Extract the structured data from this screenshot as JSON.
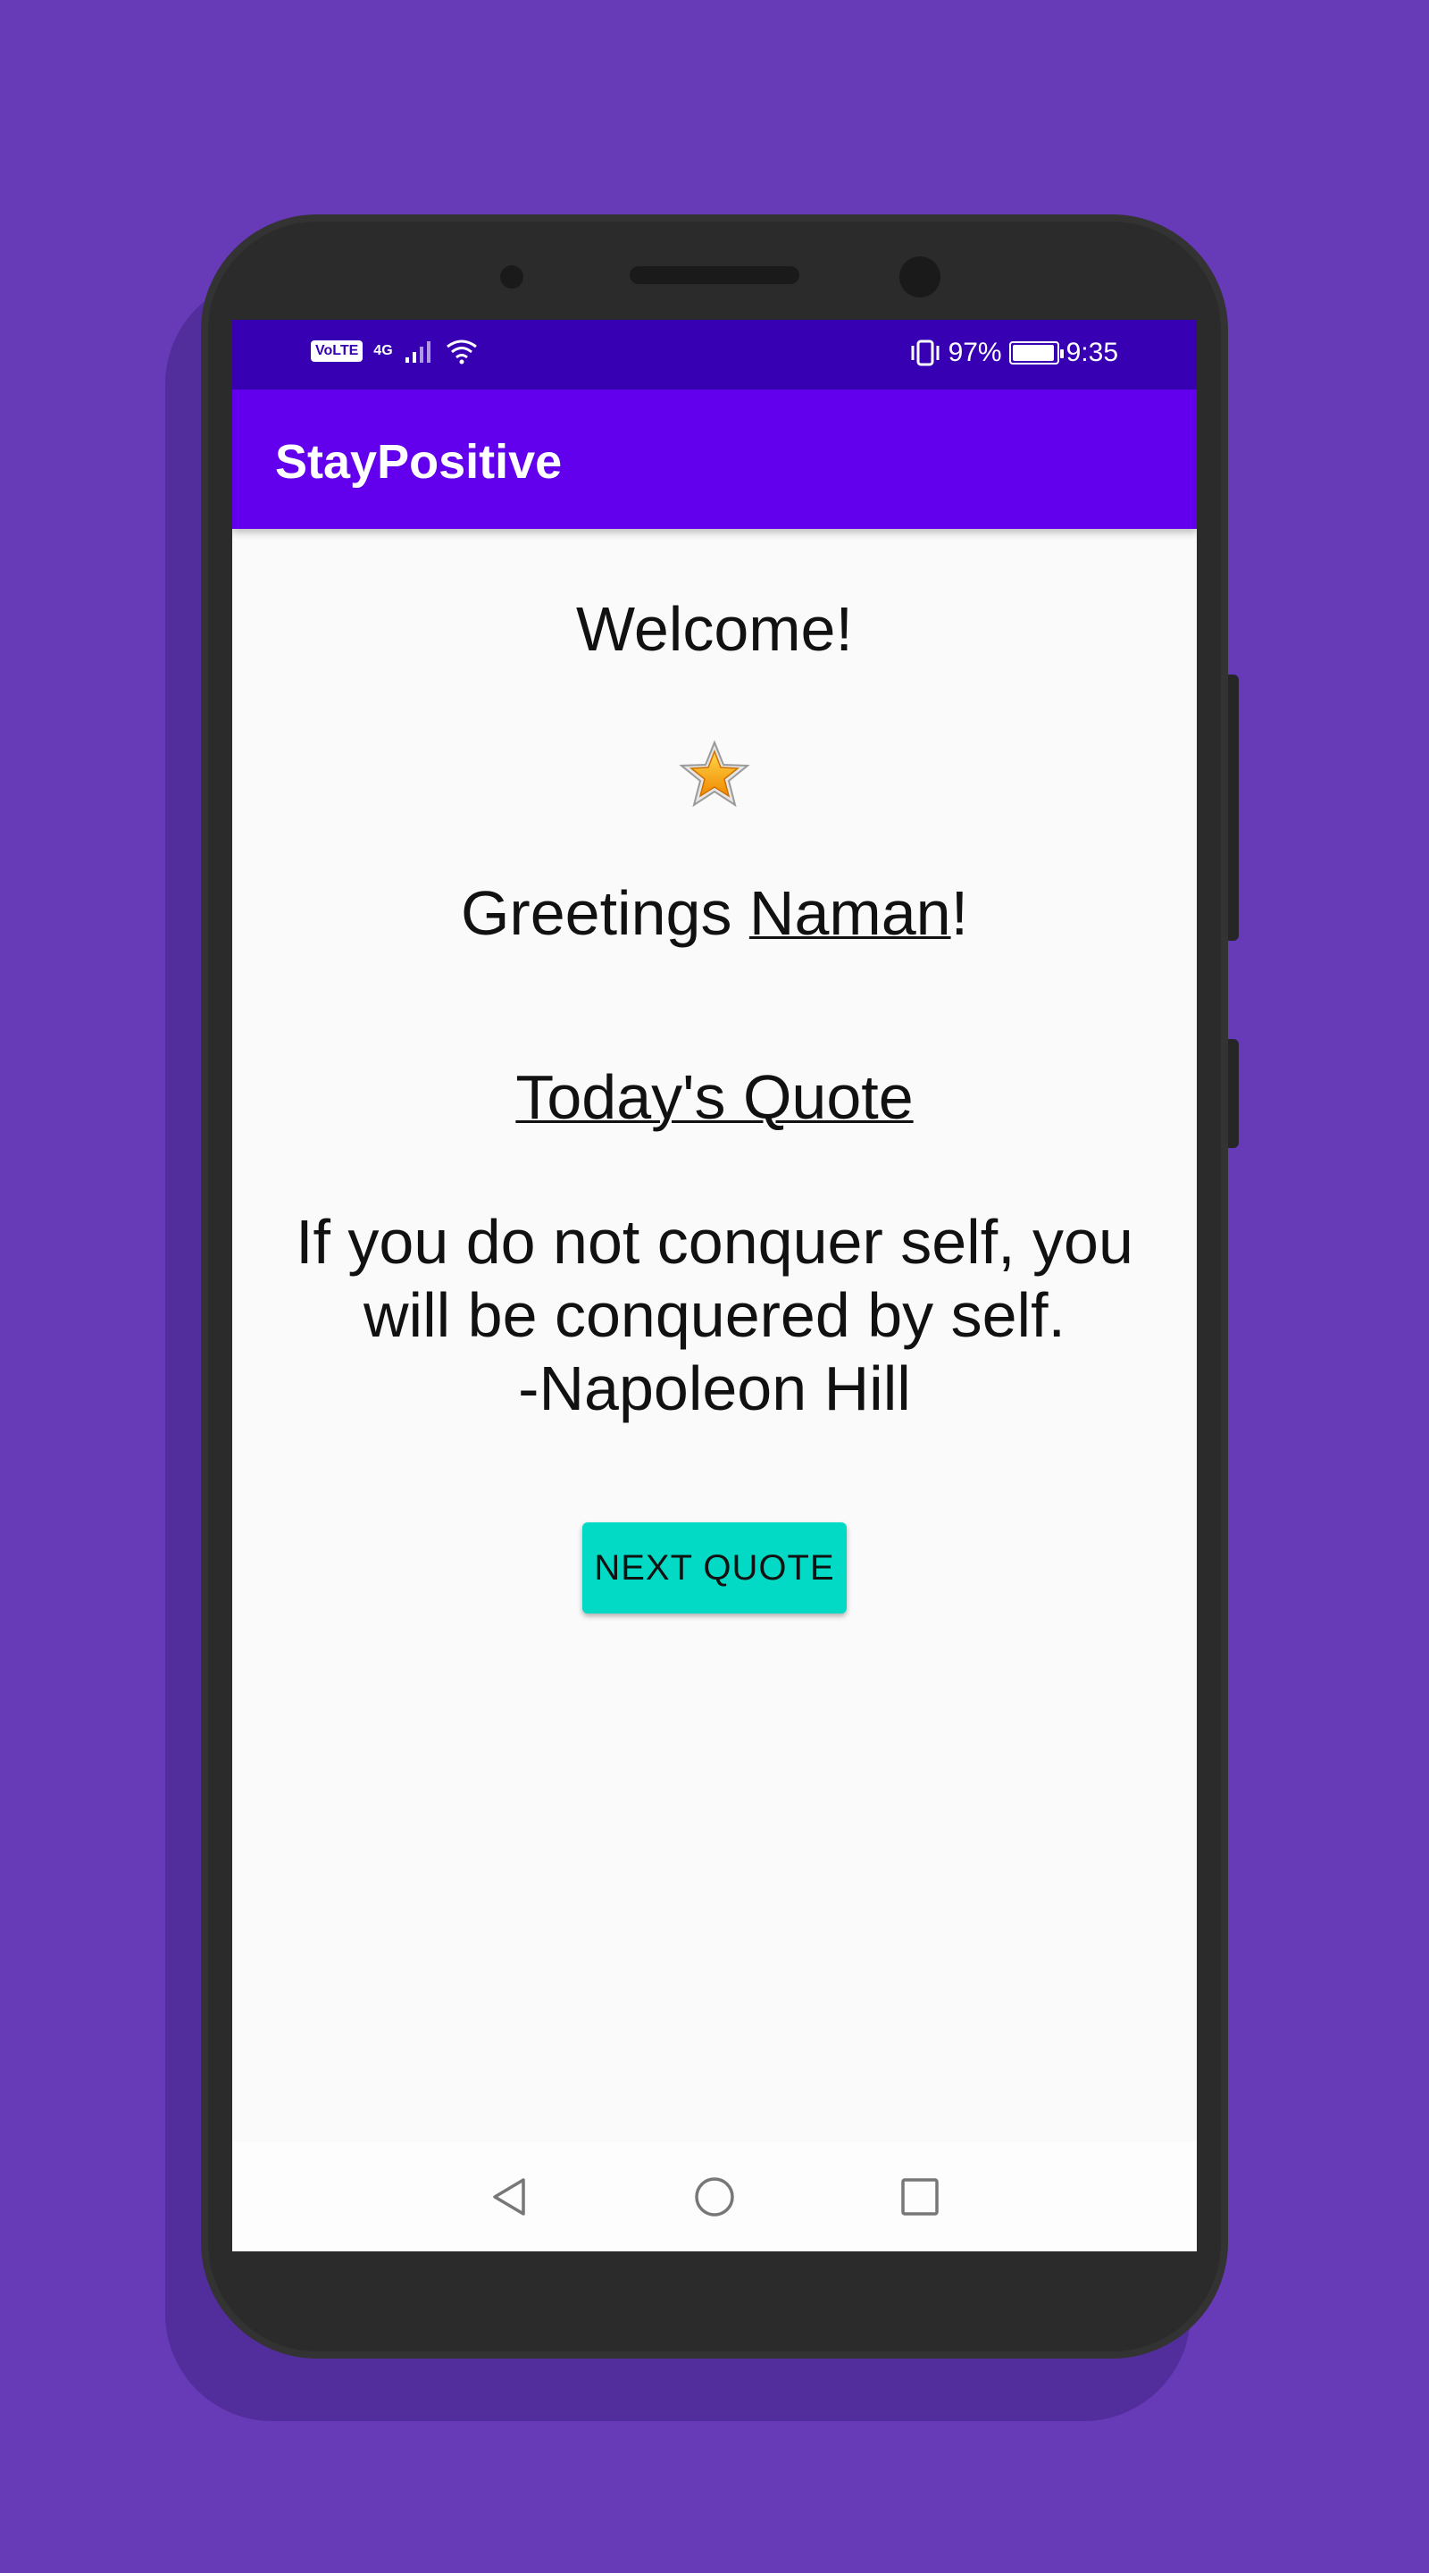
{
  "status_bar": {
    "network_badge": "VoLTE",
    "network_type": "4G",
    "battery_percent": "97%",
    "battery_level": 0.97,
    "time": "9:35",
    "icons": [
      "volte-icon",
      "signal-icon",
      "wifi-icon",
      "vibrate-icon",
      "battery-icon"
    ]
  },
  "app_bar": {
    "title": "StayPositive"
  },
  "main": {
    "welcome_text": "Welcome!",
    "star_icon": "star-icon",
    "greeting_prefix": "Greetings ",
    "user_name": "Naman",
    "greeting_suffix": "!",
    "quote_heading": "Today's Quote",
    "quote_line1": "If you do not conquer self, you",
    "quote_line2": "will be conquered by self.",
    "quote_author": "-Napoleon Hill",
    "next_button_label": "NEXT QUOTE"
  },
  "nav_bar": {
    "icons": [
      "back-icon",
      "home-icon",
      "recents-icon"
    ]
  },
  "colors": {
    "background": "#673ab7",
    "status_bar": "#3700b3",
    "app_bar": "#6200ee",
    "button": "#03dac5"
  }
}
